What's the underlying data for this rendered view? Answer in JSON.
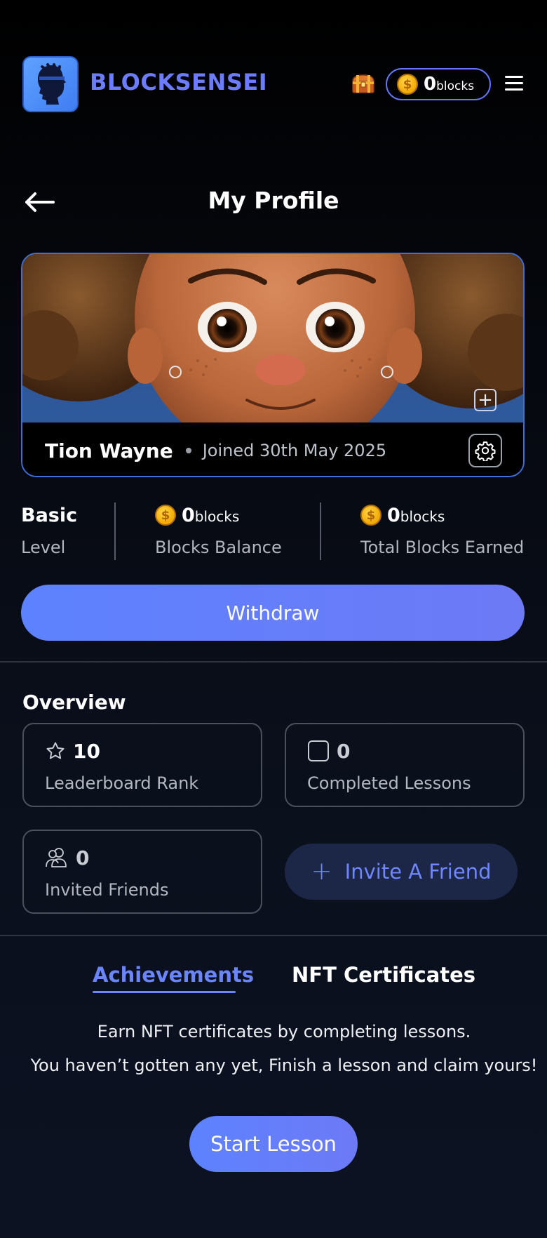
{
  "header": {
    "brand": "BLOCKSENSEI",
    "balance_value": "0",
    "balance_unit": "blocks",
    "coin_symbol": "$"
  },
  "page": {
    "title": "My Profile"
  },
  "profile": {
    "name": "Tion Wayne",
    "joined": "Joined 30th May 2025"
  },
  "stats": {
    "level_value": "Basic",
    "level_label": "Level",
    "balance_value": "0",
    "balance_unit": "blocks",
    "balance_label": "Blocks Balance",
    "earned_value": "0",
    "earned_unit": "blocks",
    "earned_label": "Total Blocks Earned"
  },
  "actions": {
    "withdraw_label": "Withdraw",
    "invite_label": "Invite A Friend",
    "start_lesson_label": "Start Lesson"
  },
  "overview": {
    "title": "Overview",
    "rank_value": "10",
    "rank_label": "Leaderboard Rank",
    "lessons_value": "0",
    "lessons_label": "Completed Lessons",
    "friends_value": "0",
    "friends_label": "Invited Friends"
  },
  "tabs": {
    "achievements": "Achievements",
    "nft": "NFT Certificates",
    "active": "Achievements"
  },
  "nft_empty": {
    "line1": "Earn NFT certificates by completing lessons.",
    "line2": "You haven’t gotten any yet, Finish a lesson and claim yours!"
  },
  "colors": {
    "accent": "#6b85ff",
    "brand": "#6b7cff",
    "card_border": "#3f6fd8"
  }
}
